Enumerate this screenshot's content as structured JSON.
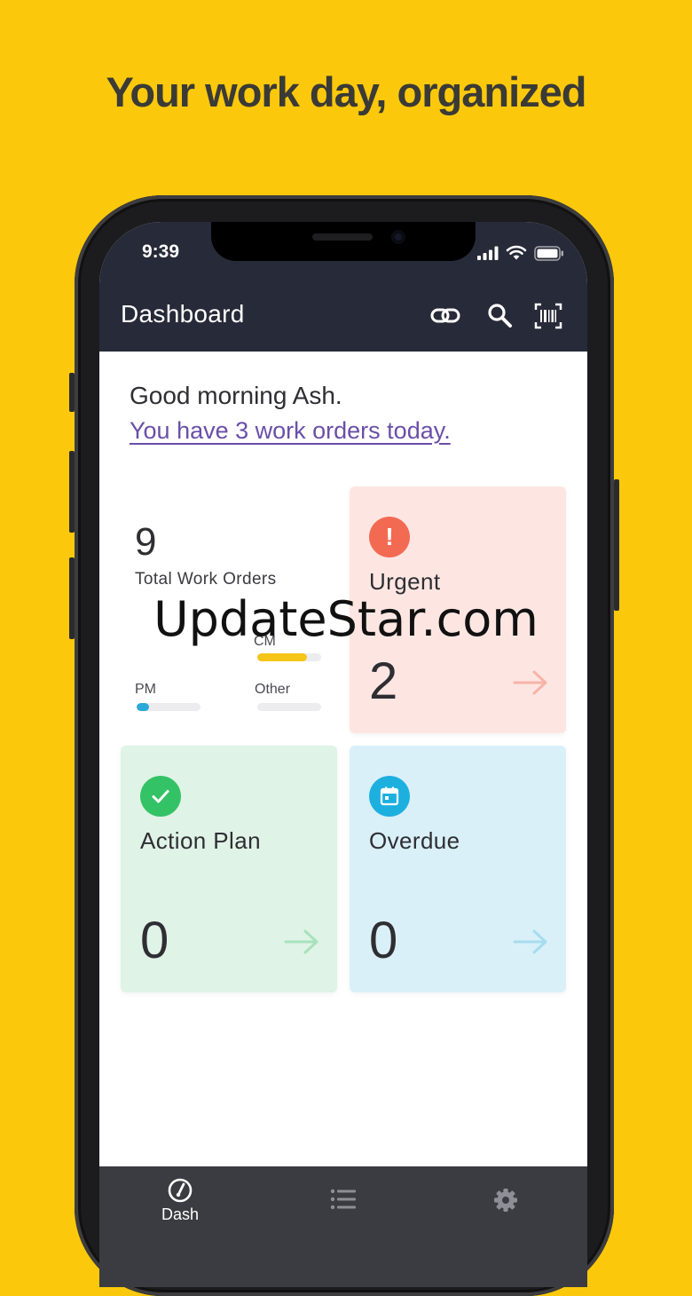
{
  "headline": "Your work day, organized",
  "status_bar": {
    "time": "9:39"
  },
  "app_bar": {
    "title": "Dashboard"
  },
  "greeting": "Good morning Ash.",
  "work_orders_link": "You have 3 work orders today.",
  "summary": {
    "total": "9",
    "total_label": "Total Work Orders",
    "categories": [
      {
        "label": "CM",
        "fraction": 0.78,
        "color": "#f5c518"
      },
      {
        "label": "PM",
        "fraction": 0.2,
        "color": "#2aa9d8"
      },
      {
        "label": "Other",
        "fraction": 0.0,
        "color": "#e0e0e0"
      }
    ]
  },
  "cards": {
    "urgent": {
      "title": "Urgent",
      "count": "2",
      "icon_glyph": "!",
      "bg": "#fde6e2",
      "accent": "#f36a52"
    },
    "action_plan": {
      "title": "Action Plan",
      "count": "0",
      "bg": "#dff3e6",
      "accent": "#34c266"
    },
    "overdue": {
      "title": "Overdue",
      "count": "0",
      "bg": "#d9f0f8",
      "accent": "#1db0df"
    }
  },
  "watermark": "UpdateStar.com",
  "bottom_nav": {
    "dash_label": "Dash"
  }
}
